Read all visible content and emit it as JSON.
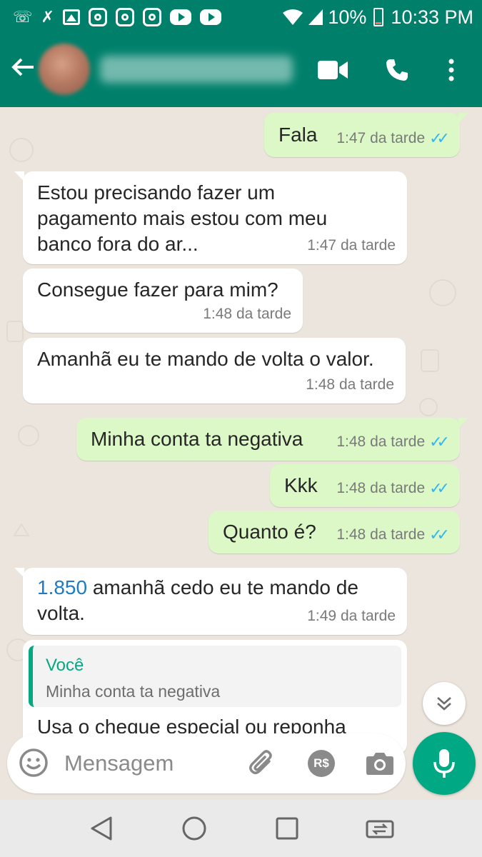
{
  "status_bar": {
    "battery": "10%",
    "time": "10:33 PM",
    "notification_icons": [
      "messages-icon",
      "wifi-calling-icon",
      "missed-call-icon",
      "gallery-icon",
      "instagram-icon",
      "instagram-icon",
      "instagram-icon",
      "youtube-icon",
      "youtube-icon"
    ]
  },
  "header": {
    "back_icon": "arrow-left-icon",
    "actions": [
      "video-call-icon",
      "voice-call-icon",
      "more-vert-icon"
    ]
  },
  "messages": [
    {
      "direction": "out",
      "text": "Fala",
      "time": "1:47 da tarde",
      "read": true
    },
    {
      "direction": "in",
      "lines": [
        "Estou precisando fazer um",
        "pagamento mais estou com meu",
        "banco fora do ar..."
      ],
      "time": "1:47 da tarde"
    },
    {
      "direction": "in",
      "text": "Consegue fazer para mim?",
      "time": "1:48 da tarde"
    },
    {
      "direction": "in",
      "text": "Amanhã eu te mando de volta o valor.",
      "time": "1:48 da tarde"
    },
    {
      "direction": "out",
      "text": "Minha conta ta negativa",
      "time": "1:48 da tarde",
      "read": true
    },
    {
      "direction": "out",
      "text": "Kkk",
      "time": "1:48 da tarde",
      "read": true
    },
    {
      "direction": "out",
      "text": "Quanto é?",
      "time": "1:48 da tarde",
      "read": true
    },
    {
      "direction": "in",
      "link_text": "1.850",
      "line1_rest": " amanhã cedo eu te mando de",
      "line2": "volta.",
      "time": "1:49 da tarde"
    },
    {
      "direction": "in",
      "quote_author": "Você",
      "quote_text": "Minha conta ta negativa",
      "partial_text": "Usa o cheque especial ou reponha"
    }
  ],
  "input": {
    "placeholder": "Mensagem",
    "value": "",
    "pay_badge": "R$"
  },
  "colors": {
    "header": "#00806b",
    "outgoing_bubble": "#dcf8c6",
    "incoming_bubble": "#ffffff",
    "accent": "#00a884",
    "read_ticks": "#34b7f1"
  }
}
